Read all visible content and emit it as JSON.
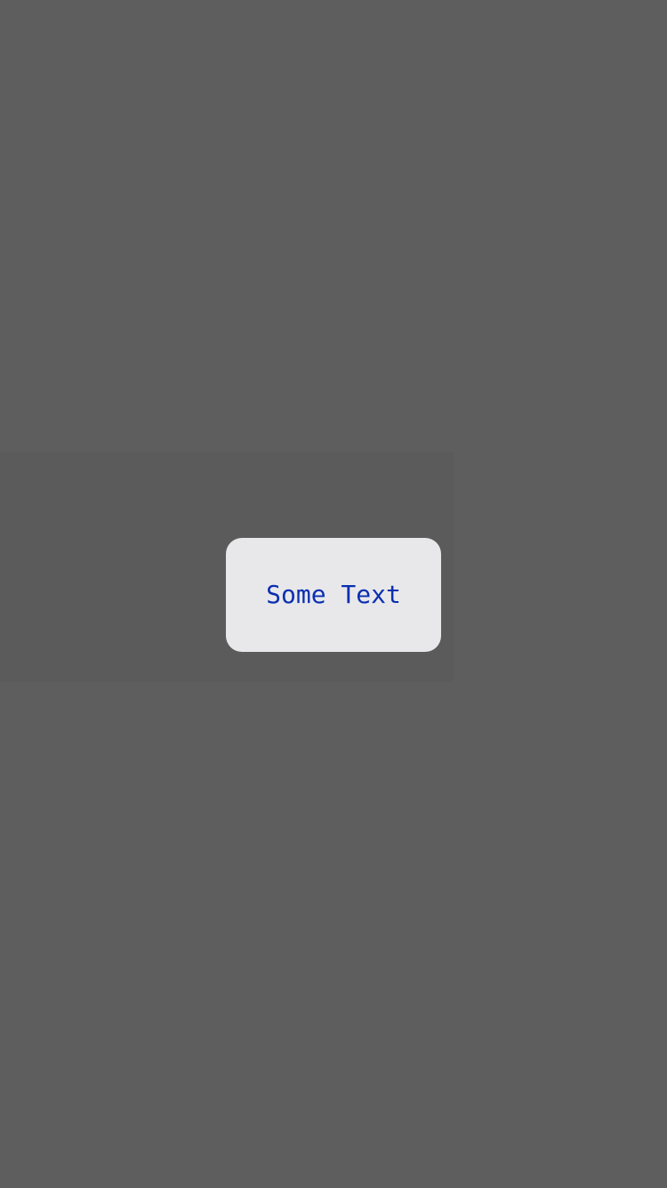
{
  "toast": {
    "text": "Some Text"
  },
  "colors": {
    "background": "#5e5e5e",
    "backdrop_panel": "#5b5b5b",
    "toast_background": "#e8e8eb",
    "toast_text": "#0a2fb0"
  }
}
